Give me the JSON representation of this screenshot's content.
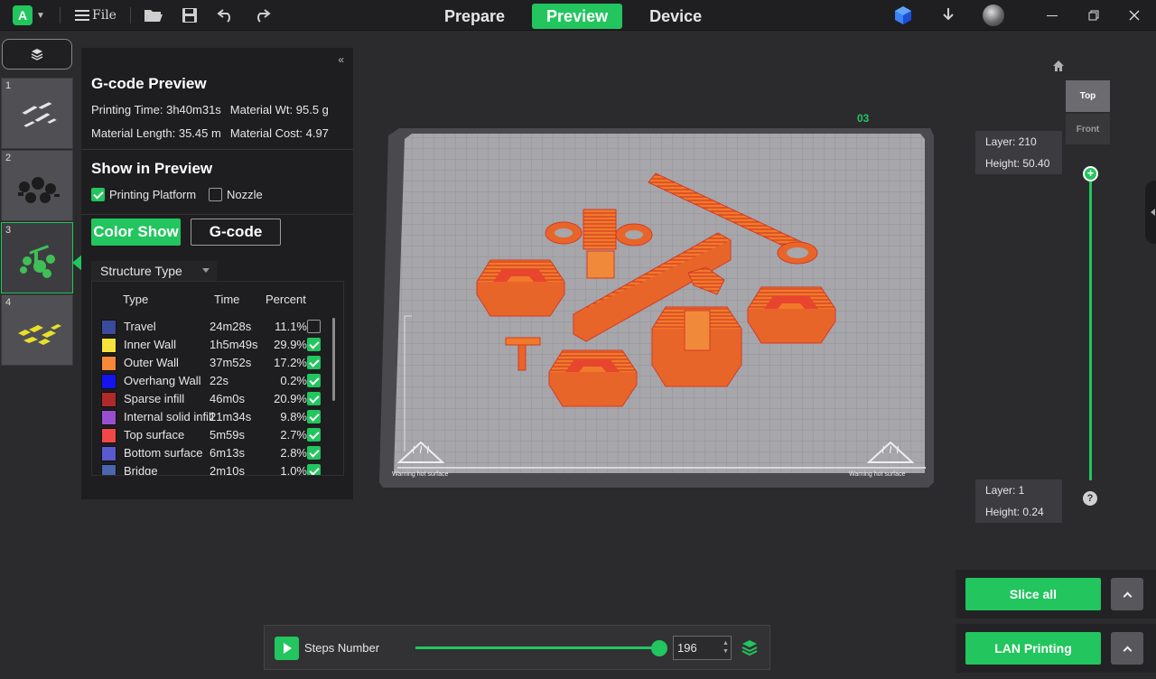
{
  "topbar": {
    "logo": "A",
    "file_label": "File",
    "tabs": [
      {
        "label": "Prepare",
        "active": false
      },
      {
        "label": "Preview",
        "active": true
      },
      {
        "label": "Device",
        "active": false
      }
    ],
    "icons": [
      "open-folder-icon",
      "save-icon",
      "undo-icon",
      "redo-icon",
      "cube-store-icon",
      "download-icon",
      "avatar",
      "minimize-icon",
      "restore-icon",
      "close-icon"
    ]
  },
  "thumbnails": [
    {
      "num": "1",
      "active": false
    },
    {
      "num": "2",
      "active": false
    },
    {
      "num": "3",
      "active": true
    },
    {
      "num": "4",
      "active": false
    }
  ],
  "panel": {
    "collapse": "«",
    "title": "G-code Preview",
    "printing_time": "Printing Time: 3h40m31s",
    "material_wt": "Material Wt: 95.5 g",
    "material_length": "Material Length: 35.45 m",
    "material_cost": "Material Cost: 4.97",
    "show_title": "Show in Preview",
    "printing_platform": {
      "label": "Printing Platform",
      "checked": true
    },
    "nozzle": {
      "label": "Nozzle",
      "checked": false
    },
    "mode_on": "Color Show",
    "mode_off": "G-code",
    "structure_select": "Structure Type",
    "headers": {
      "type": "Type",
      "time": "Time",
      "percent": "Percent"
    },
    "rows": [
      {
        "type": "Travel",
        "time": "24m28s",
        "percent": "11.1%",
        "color": "#3a4a9c",
        "checked": false
      },
      {
        "type": "Inner Wall",
        "time": "1h5m49s",
        "percent": "29.9%",
        "color": "#f5e23a",
        "checked": true
      },
      {
        "type": "Outer Wall",
        "time": "37m52s",
        "percent": "17.2%",
        "color": "#f7883a",
        "checked": true
      },
      {
        "type": "Overhang Wall",
        "time": "22s",
        "percent": "0.2%",
        "color": "#1414f0",
        "checked": true
      },
      {
        "type": "Sparse infill",
        "time": "46m0s",
        "percent": "20.9%",
        "color": "#b02a2a",
        "checked": true
      },
      {
        "type": "Internal solid infill",
        "time": "21m34s",
        "percent": "9.8%",
        "color": "#9a4fd0",
        "checked": true
      },
      {
        "type": "Top surface",
        "time": "5m59s",
        "percent": "2.7%",
        "color": "#f04848",
        "checked": true
      },
      {
        "type": "Bottom surface",
        "time": "6m13s",
        "percent": "2.8%",
        "color": "#5a5ad0",
        "checked": true
      },
      {
        "type": "Bridge",
        "time": "2m10s",
        "percent": "1.0%",
        "color": "#4a66b0",
        "checked": true
      }
    ]
  },
  "plate": {
    "label": "03",
    "warning_left": "Warning hot surface",
    "warning_right": "Warning hot surface"
  },
  "nav_cube": {
    "top": "Top",
    "front": "Front"
  },
  "layer_slider": {
    "top_layer": "Layer: 210",
    "top_height": "Height: 50.40",
    "bottom_layer": "Layer: 1",
    "bottom_height": "Height: 0.24",
    "help": "?",
    "knob": "+"
  },
  "actions": {
    "slice_all": "Slice all",
    "lan_printing": "LAN Printing"
  },
  "steps": {
    "label": "Steps Number",
    "value": "196",
    "progress": 1.0
  }
}
